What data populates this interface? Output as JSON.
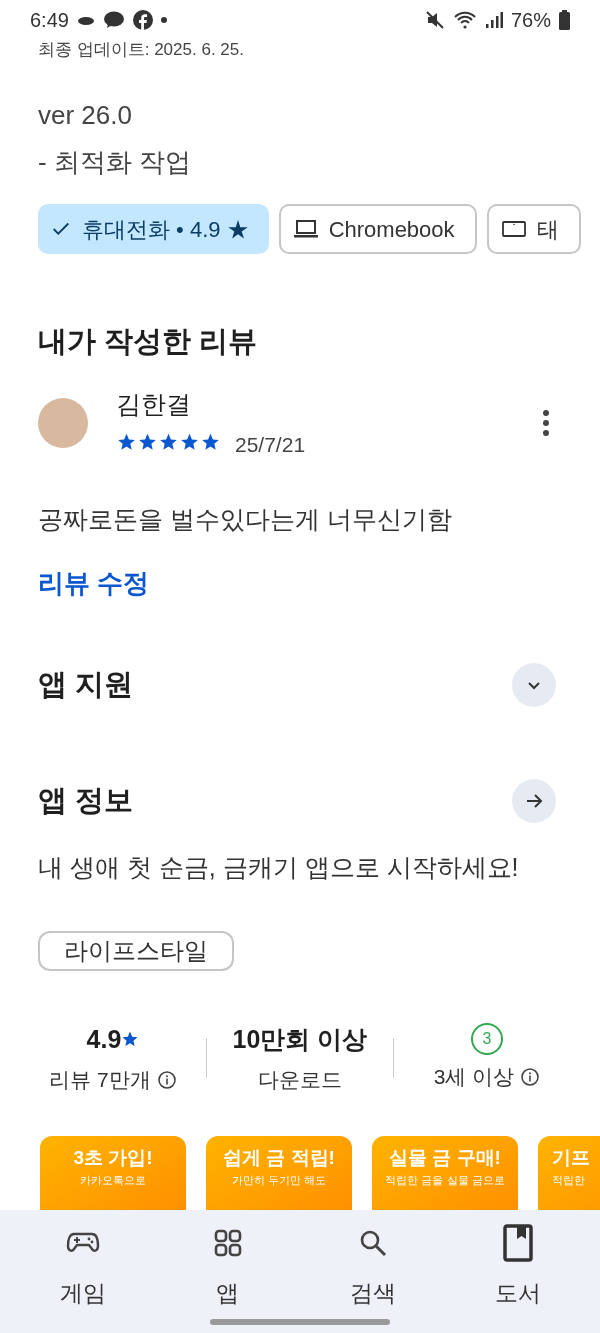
{
  "status_bar": {
    "time": "6:49",
    "battery": "76%"
  },
  "update": {
    "date_line": "최종 업데이트: 2025. 6. 25.",
    "version": "ver 26.0",
    "note": "- 최적화 작업"
  },
  "device_chips": [
    {
      "kind": "phone",
      "label": "휴대전화 • 4.9 ★",
      "selected": true
    },
    {
      "kind": "laptop",
      "label": "Chromebook",
      "selected": false
    },
    {
      "kind": "tablet",
      "label": "태",
      "selected": false
    }
  ],
  "my_review": {
    "heading": "내가 작성한 리뷰",
    "author": "김한결",
    "stars": 5,
    "date": "25/7/21",
    "text": "공짜로돈을 벌수있다는게 너무신기함",
    "edit_link": "리뷰 수정"
  },
  "sections": [
    {
      "title": "앱 지원",
      "kind": "expand"
    },
    {
      "title": "앱 정보",
      "kind": "arrow"
    }
  ],
  "description": "내 생애 첫 순금, 금캐기 앱으로 시작하세요!",
  "category_chip": "라이프스타일",
  "stats": [
    {
      "kind": "rating",
      "value": "4.9",
      "label": "리뷰 7만개"
    },
    {
      "kind": "downloads",
      "value": "10만회 이상",
      "label": "다운로드"
    },
    {
      "kind": "age",
      "value": "3",
      "label": "3세 이상"
    }
  ],
  "screenshots": [
    {
      "title": "3초 가입!",
      "subtitle": "카카오톡으로"
    },
    {
      "title": "쉽게 금 적립!",
      "subtitle": "가만히 두기만 해도"
    },
    {
      "title": "실물 금 구매!",
      "subtitle": "적립한 금을 실물 금으로"
    },
    {
      "title": "기프",
      "subtitle": "적립한"
    }
  ],
  "bottom_nav": [
    {
      "kind": "games",
      "label": "게임",
      "selected": false
    },
    {
      "kind": "apps",
      "label": "앱",
      "selected": false
    },
    {
      "kind": "search",
      "label": "검색",
      "selected": false
    },
    {
      "kind": "books",
      "label": "도서",
      "selected": false
    }
  ]
}
